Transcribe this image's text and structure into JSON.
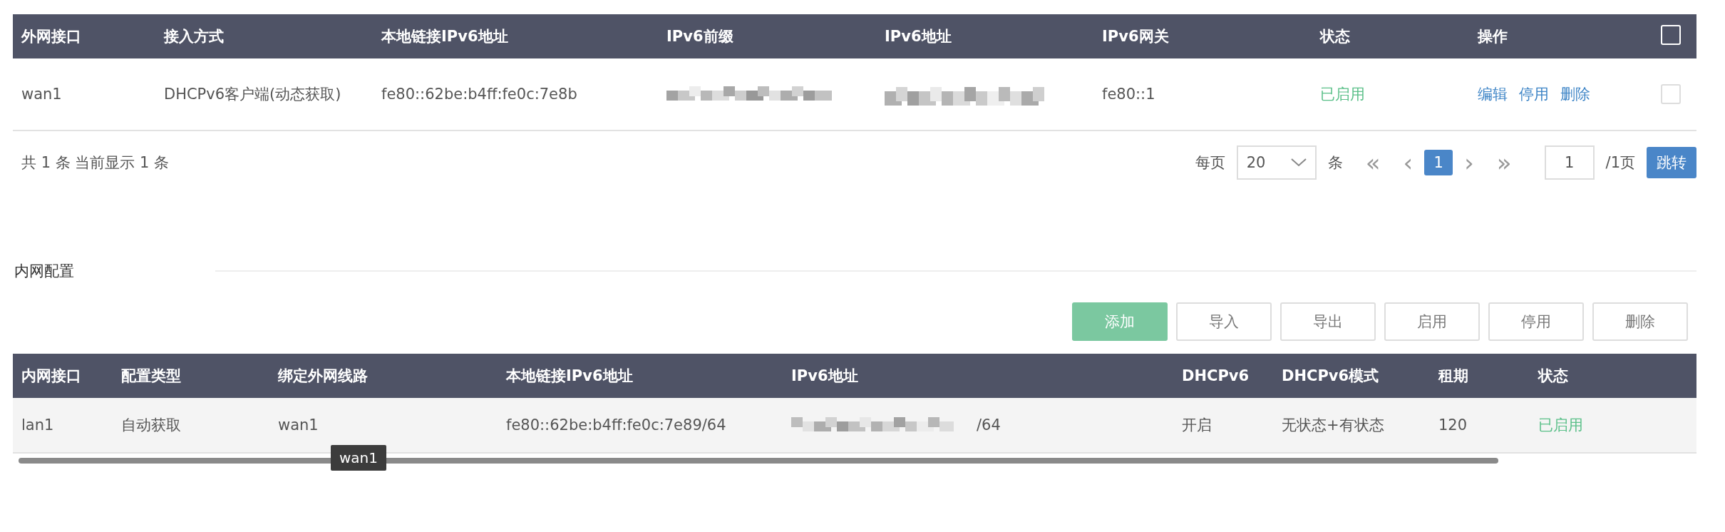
{
  "wan_table": {
    "columns": [
      "外网接口",
      "接入方式",
      "本地链接IPv6地址",
      "IPv6前缀",
      "IPv6地址",
      "IPv6网关",
      "状态",
      "操作"
    ],
    "select_all": {
      "checked": false
    },
    "rows": [
      {
        "interface": "wan1",
        "access": "DHCPv6客户端(动态获取)",
        "link_local": "fe80::62be:b4ff:fe0c:7e8b",
        "prefix": {
          "kind": "blurred"
        },
        "address": {
          "kind": "blurred"
        },
        "gateway": "fe80::1",
        "status": {
          "text": "已启用",
          "enabled": true
        },
        "actions": [
          "编辑",
          "停用",
          "删除"
        ],
        "checked": false
      }
    ]
  },
  "wan_footer": {
    "summary": "共 1 条 当前显示 1 条",
    "per_page_label": "每页",
    "per_page": "20",
    "per_page_unit": "条",
    "first": "«",
    "prev": "‹",
    "pages": [
      {
        "label": "1",
        "selected": true
      }
    ],
    "next": "›",
    "last": "»",
    "page_input": "1",
    "page_total": "/1页",
    "jump": "跳转"
  },
  "lan_section": {
    "title": "内网配置",
    "buttons": [
      {
        "label": "添加",
        "kind": "primary"
      },
      {
        "label": "导入",
        "kind": "plain"
      },
      {
        "label": "导出",
        "kind": "plain"
      },
      {
        "label": "启用",
        "kind": "plain"
      },
      {
        "label": "停用",
        "kind": "plain"
      },
      {
        "label": "删除",
        "kind": "plain"
      }
    ]
  },
  "lan_table": {
    "columns": [
      "内网接口",
      "配置类型",
      "绑定外网线路",
      "本地链接IPv6地址",
      "IPv6地址",
      "DHCPv6",
      "DHCPv6模式",
      "租期",
      "状态"
    ],
    "rows": [
      {
        "interface": "lan1",
        "config_type": "自动获取",
        "wan_line": "wan1",
        "link_local": "fe80::62be:b4ff:fe0c:7e89/64",
        "address": {
          "kind": "blurred",
          "visible_tail": "/64"
        },
        "dhcpv6": "开启",
        "dhcpv6_mode": "无状态+有状态",
        "lease": "120",
        "status": {
          "text": "已启用",
          "enabled": true
        }
      }
    ],
    "tooltip": "wan1"
  }
}
